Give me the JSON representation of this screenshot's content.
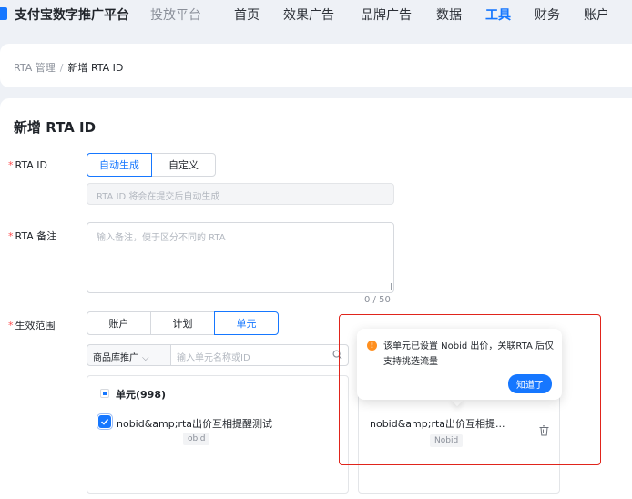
{
  "topnav": {
    "brand": "支付宝数字推广平台",
    "brand_sub": "投放平台",
    "items": [
      {
        "label": "首页"
      },
      {
        "label": "效果广告"
      },
      {
        "label": "品牌广告"
      },
      {
        "label": "数据"
      },
      {
        "label": "工具",
        "active": true
      },
      {
        "label": "财务"
      },
      {
        "label": "账户"
      }
    ]
  },
  "breadcrumb": {
    "parent": "RTA 管理",
    "separator": "/",
    "current": "新增 RTA ID"
  },
  "page_title": "新增 RTA ID",
  "form": {
    "rta_id": {
      "label": "RTA ID",
      "options": [
        "自动生成",
        "自定义"
      ],
      "selected": "自动生成",
      "placeholder": "RTA ID 将会在提交后自动生成"
    },
    "remark": {
      "label": "RTA 备注",
      "placeholder": "输入备注，便于区分不同的 RTA",
      "counter": "0 / 50"
    },
    "scope": {
      "label": "生效范围",
      "options": [
        "账户",
        "计划",
        "单元"
      ],
      "selected": "单元",
      "select_value": "商品库推广",
      "search_placeholder": "输入单元名称或ID",
      "group_title": "单元(998)",
      "unit_name": "nobid&amp;rta出价互相提醒测试",
      "unit_tag": "obid",
      "selected_unit_name": "nobid&amp;rta出价互相提...",
      "selected_unit_tag": "Nobid"
    }
  },
  "popover": {
    "text": "该单元已设置 Nobid 出价，关联RTA 后仅支持挑选流量",
    "button": "知道了"
  },
  "colors": {
    "accent": "#1677ff",
    "required": "#ff4d4f",
    "warning": "#ff8f1f",
    "highlight_box": "#e0241b"
  }
}
